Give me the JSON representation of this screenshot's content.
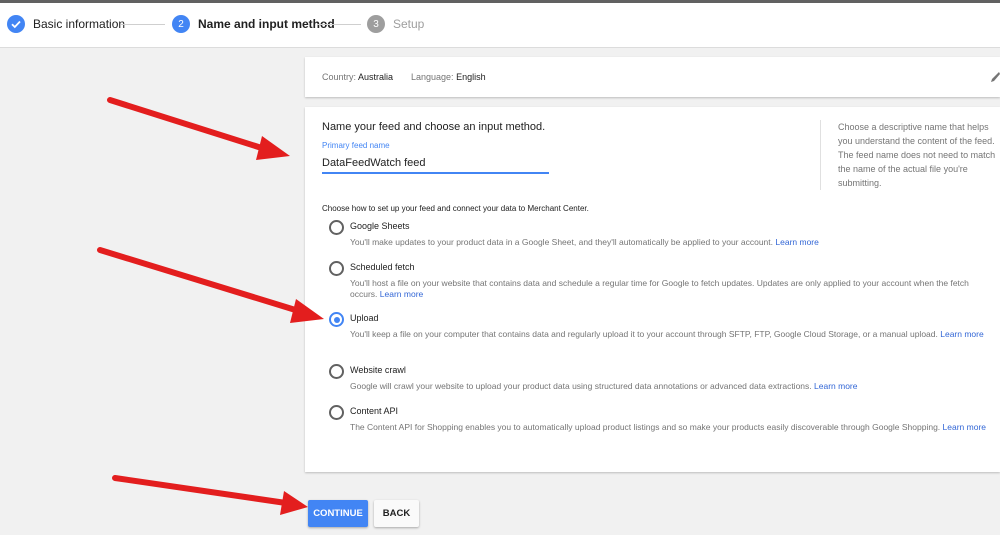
{
  "colors": {
    "accent": "#4285f4",
    "step_done": "#4285f4",
    "step_active": "#4285f4",
    "step_pending": "#9e9e9e",
    "link": "#3367d6",
    "annotation_arrow": "#e31e1e"
  },
  "stepper": {
    "steps": [
      {
        "number": "",
        "label": "Basic information",
        "state": "done",
        "icon": "check-icon"
      },
      {
        "number": "2",
        "label": "Name and input method",
        "state": "active"
      },
      {
        "number": "3",
        "label": "Setup",
        "state": "pending"
      }
    ]
  },
  "summary": {
    "country_label": "Country:",
    "country_value": "Australia",
    "language_label": "Language:",
    "language_value": "English",
    "edit_icon": "pencil-icon"
  },
  "feed": {
    "heading": "Name your feed and choose an input method.",
    "field_label": "Primary feed name",
    "field_value": "DataFeedWatch feed",
    "help_text": "Choose a descriptive name that helps you understand the content of the feed. The feed name does not need to match the name of the actual file you're submitting."
  },
  "input_method": {
    "prompt": "Choose how to set up your feed and connect your data to Merchant Center.",
    "selected": "Upload",
    "options": [
      {
        "title": "Google Sheets",
        "description": "You'll make updates to your product data in a Google Sheet, and they'll automatically be applied to your account.",
        "link": "Learn more"
      },
      {
        "title": "Scheduled fetch",
        "description": "You'll host a file on your website that contains data and schedule a regular time for Google to fetch updates. Updates are only applied to your account when the fetch occurs.",
        "link": "Learn more"
      },
      {
        "title": "Upload",
        "description": "You'll keep a file on your computer that contains data and regularly upload it to your account through SFTP, FTP, Google Cloud Storage, or a manual upload.",
        "link": "Learn more"
      },
      {
        "title": "Website crawl",
        "description": "Google will crawl your website to upload your product data using structured data annotations or advanced data extractions.",
        "link": "Learn more"
      },
      {
        "title": "Content API",
        "description": "The Content API for Shopping enables you to automatically upload product listings and so make your products easily discoverable through Google Shopping.",
        "link": "Learn more"
      }
    ]
  },
  "actions": {
    "continue_label": "CONTINUE",
    "back_label": "BACK"
  }
}
